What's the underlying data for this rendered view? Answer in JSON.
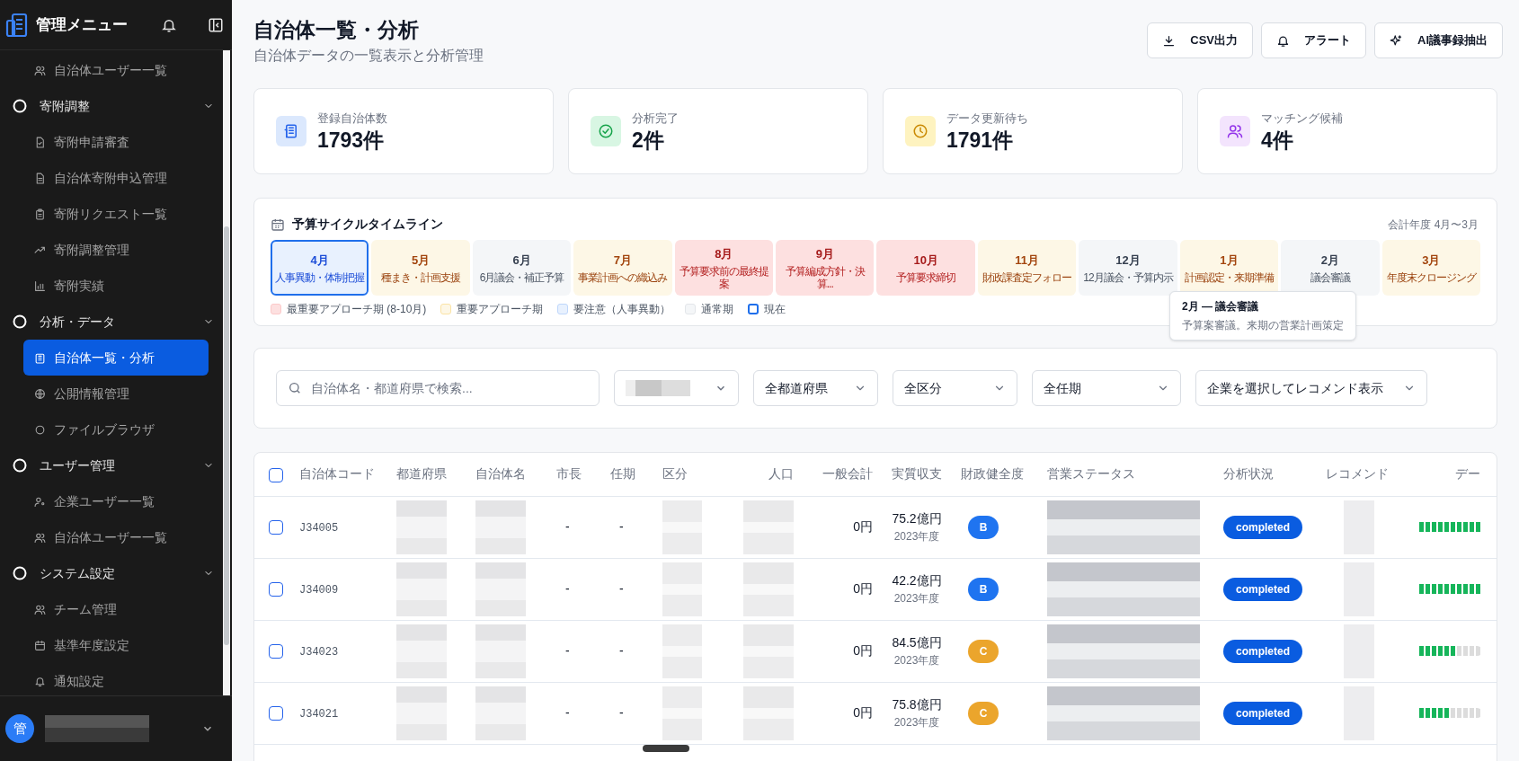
{
  "sidebar": {
    "title": "管理メニュー",
    "items": [
      {
        "kind": "link",
        "label": "自治体ユーザー一覧",
        "selected": false
      },
      {
        "kind": "group",
        "label": "寄附調整",
        "expanded": true,
        "children": [
          {
            "label": "寄附申請審査",
            "selected": false
          },
          {
            "label": "自治体寄附申込管理",
            "selected": false
          },
          {
            "label": "寄附リクエスト一覧",
            "selected": false
          },
          {
            "label": "寄附調整管理",
            "selected": false
          },
          {
            "label": "寄附実績",
            "selected": false
          }
        ]
      },
      {
        "kind": "group",
        "label": "分析・データ",
        "expanded": true,
        "children": [
          {
            "label": "自治体一覧・分析",
            "selected": true
          },
          {
            "label": "公開情報管理",
            "selected": false
          },
          {
            "label": "ファイルブラウザ",
            "selected": false
          }
        ]
      },
      {
        "kind": "group",
        "label": "ユーザー管理",
        "expanded": true,
        "children": [
          {
            "label": "企業ユーザー一覧",
            "selected": false
          },
          {
            "label": "自治体ユーザー一覧",
            "selected": false
          }
        ]
      },
      {
        "kind": "group",
        "label": "システム設定",
        "expanded": true,
        "children": [
          {
            "label": "チーム管理",
            "selected": false
          },
          {
            "label": "基準年度設定",
            "selected": false
          },
          {
            "label": "通知設定",
            "selected": false
          }
        ]
      }
    ],
    "user": {
      "avatar": "管"
    }
  },
  "page": {
    "title": "自治体一覧・分析",
    "subtitle": "自治体データの一覧表示と分析管理",
    "buttons": [
      "CSV出力",
      "アラート",
      "AI議事録抽出"
    ]
  },
  "stats": [
    {
      "label": "登録自治体数",
      "value": "1793件"
    },
    {
      "label": "分析完了",
      "value": "2件"
    },
    {
      "label": "データ更新待ち",
      "value": "1791件"
    },
    {
      "label": "マッチング候補",
      "value": "4件"
    }
  ],
  "timeline": {
    "title": "予算サイクルタイムライン",
    "fiscal_year": "会計年度 4月〜3月",
    "months": [
      {
        "month": "4月",
        "desc": "人事異動・体制把握",
        "kind": "attention",
        "selected": true
      },
      {
        "month": "5月",
        "desc": "種まき・計画支援",
        "kind": "important",
        "selected": false
      },
      {
        "month": "6月",
        "desc": "6月議会・補正予算",
        "kind": "normal",
        "selected": false
      },
      {
        "month": "7月",
        "desc": "事業計画への織込み",
        "kind": "important",
        "selected": false
      },
      {
        "month": "8月",
        "desc": "予算要求前の最終提案",
        "kind": "critical",
        "selected": false
      },
      {
        "month": "9月",
        "desc": "予算編成方針・決算...",
        "kind": "critical",
        "selected": false
      },
      {
        "month": "10月",
        "desc": "予算要求締切",
        "kind": "critical",
        "selected": false
      },
      {
        "month": "11月",
        "desc": "財政課査定フォロー",
        "kind": "important",
        "selected": false
      },
      {
        "month": "12月",
        "desc": "12月議会・予算内示",
        "kind": "normal",
        "selected": false
      },
      {
        "month": "1月",
        "desc": "計画認定・来期準備",
        "kind": "important",
        "selected": false
      },
      {
        "month": "2月",
        "desc": "議会審議",
        "kind": "normal",
        "selected": false
      },
      {
        "month": "3月",
        "desc": "年度末クロージング",
        "kind": "important",
        "selected": false
      }
    ],
    "legend": [
      {
        "label": "最重要アプローチ期 (8-10月)",
        "kind": "critical"
      },
      {
        "label": "重要アプローチ期",
        "kind": "important"
      },
      {
        "label": "要注意（人事異動）",
        "kind": "attention"
      },
      {
        "label": "通常期",
        "kind": "normal"
      },
      {
        "label": "現在",
        "kind": "current"
      }
    ],
    "tooltip": {
      "title": "2月 — 議会審議",
      "text": "予算案審議。来期の営業計画策定"
    }
  },
  "filters": {
    "search_placeholder": "自治体名・都道府県で検索...",
    "selects": [
      "全都道府県",
      "全区分",
      "全任期",
      "企業を選択してレコメンド表示"
    ]
  },
  "table": {
    "select_all_checked": false,
    "columns": [
      "自治体コード",
      "都道府県",
      "自治体名",
      "市長",
      "任期",
      "区分",
      "人口",
      "一般会計",
      "実質収支",
      "財政健全度",
      "営業ステータス",
      "分析状況",
      "レコメンド",
      "デー"
    ],
    "rows": [
      {
        "checked": false,
        "code": "J34005",
        "mayor": "-",
        "term": "-",
        "general": "0円",
        "balance": "75.2億円",
        "year": "2023年度",
        "health": "B",
        "color": "#1f74f0",
        "analysis": "completed",
        "level": 1.0
      },
      {
        "checked": false,
        "code": "J34009",
        "mayor": "-",
        "term": "-",
        "general": "0円",
        "balance": "42.2億円",
        "year": "2023年度",
        "health": "B",
        "color": "#1f74f0",
        "analysis": "completed",
        "level": 1.0
      },
      {
        "checked": false,
        "code": "J34023",
        "mayor": "-",
        "term": "-",
        "general": "0円",
        "balance": "84.5億円",
        "year": "2023年度",
        "health": "C",
        "color": "#eba52c",
        "analysis": "completed",
        "level": 0.6
      },
      {
        "checked": false,
        "code": "J34021",
        "mayor": "-",
        "term": "-",
        "general": "0円",
        "balance": "75.8億円",
        "year": "2023年度",
        "health": "C",
        "color": "#eba52c",
        "analysis": "completed",
        "level": 0.5
      }
    ]
  }
}
